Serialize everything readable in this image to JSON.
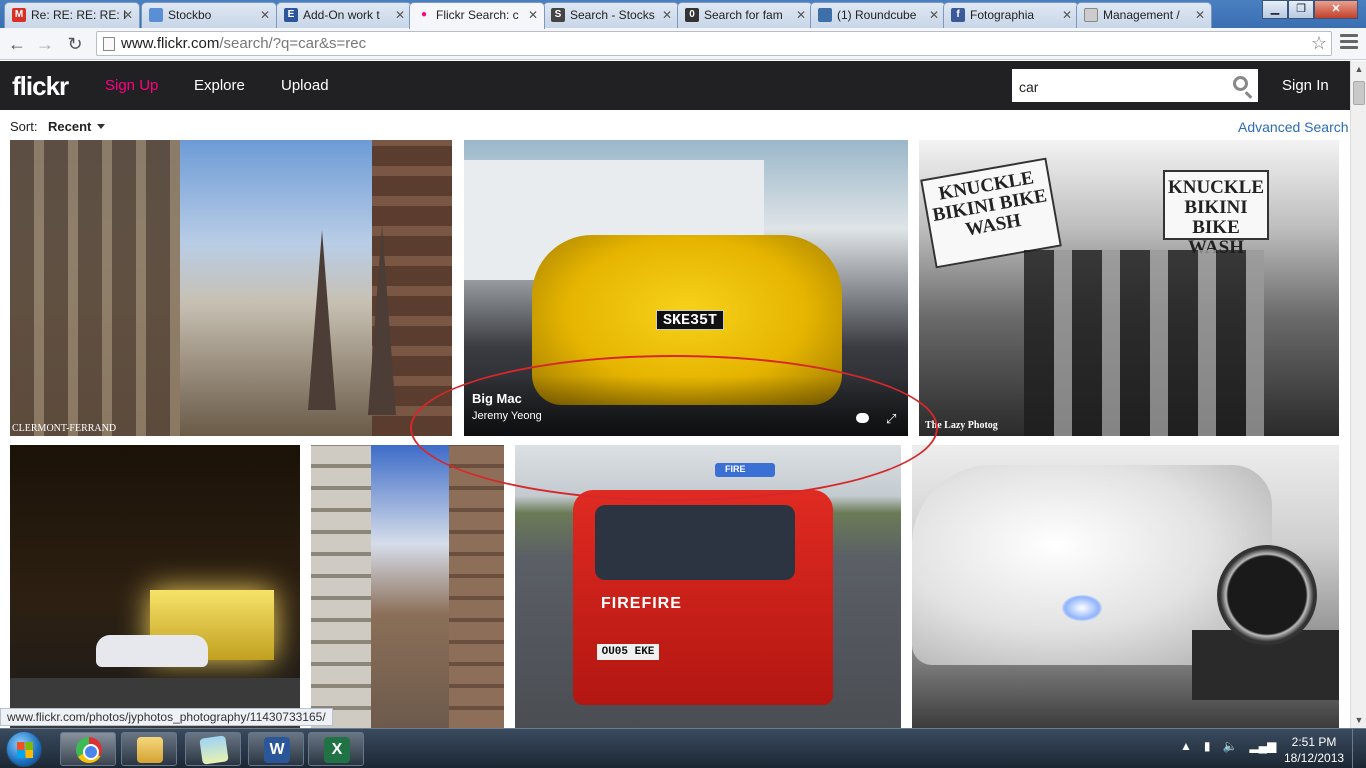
{
  "browser": {
    "tabs": [
      {
        "label": "Re: RE: RE: RE: I",
        "icon": "gmail-icon",
        "icon_color": "#d93025",
        "icon_glyph": "M"
      },
      {
        "label": "Stockbo",
        "icon": "stockbo-icon",
        "icon_color": "#5a8fd6",
        "icon_glyph": ""
      },
      {
        "label": "Add-On work t",
        "icon": "add-on-icon",
        "icon_color": "#2b579a",
        "icon_glyph": "E"
      },
      {
        "label": "Flickr Search: c",
        "icon": "flickr-icon",
        "icon_color": "#ff0084",
        "icon_glyph": "●",
        "active": true
      },
      {
        "label": "Search - Stocks",
        "icon": "stocksy-icon",
        "icon_color": "#444444",
        "icon_glyph": "S"
      },
      {
        "label": "Search for fam",
        "icon": "search-site-icon",
        "icon_color": "#333333",
        "icon_glyph": "0"
      },
      {
        "label": "(1) Roundcube",
        "icon": "roundcube-icon",
        "icon_color": "#3d6fa8",
        "icon_glyph": ""
      },
      {
        "label": "Fotographia",
        "icon": "facebook-icon",
        "icon_color": "#3b5998",
        "icon_glyph": "f"
      },
      {
        "label": "Management /",
        "icon": "document-icon",
        "icon_color": "#cccccc",
        "icon_glyph": ""
      }
    ],
    "url_host": "www.flickr.com",
    "url_path": "/search/?q=car&s=rec"
  },
  "flickr": {
    "logo": "flickr",
    "nav": {
      "sign_up": "Sign Up",
      "explore": "Explore",
      "upload": "Upload"
    },
    "search_value": "car",
    "sign_in": "Sign In",
    "sort_label": "Sort:",
    "sort_value": "Recent",
    "advanced_search": "Advanced Search"
  },
  "photos": {
    "p1": {
      "caption": "CLERMONT-FERRAND"
    },
    "p2": {
      "title": "Big Mac",
      "owner": "Jeremy Yeong",
      "plate": "SKE35T"
    },
    "p3": {
      "sign1": "KNUCKLE BIKINI BIKE WASH",
      "sign2": "KNUCKLE BIKINI BIKE WASH",
      "watermark": "The Lazy Photog"
    },
    "p6": {
      "side_text": "FIREFIRE",
      "plate": "OU05 EKE",
      "roof_sign": "FIRE"
    }
  },
  "status_url": "www.flickr.com/photos/jyphotos_photography/11430733165/",
  "taskbar": {
    "time": "2:51 PM",
    "date": "18/12/2013",
    "apps": [
      {
        "name": "chrome-icon"
      },
      {
        "name": "windows-explorer-icon"
      },
      {
        "name": "sticky-notes-icon"
      },
      {
        "name": "word-icon",
        "glyph": "W"
      },
      {
        "name": "excel-icon",
        "glyph": "X"
      }
    ]
  },
  "colors": {
    "flickr_pink": "#ff0084",
    "flickr_header": "#212124",
    "link_blue": "#2a6bbf",
    "annotation_red": "#d6282a"
  }
}
